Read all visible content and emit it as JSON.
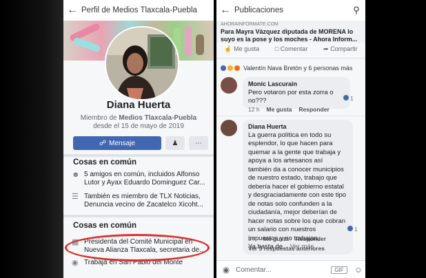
{
  "left": {
    "header_title": "Perfil de Medios Tlaxcala-Puebla",
    "profile_name": "Diana Huerta",
    "member_line_prefix": "Miembro de ",
    "member_group": "Medios Tlaxcala-Puebla",
    "member_since": "desde el 15 de mayo de 2019",
    "message_button": "Mensaje",
    "section1_title": "Cosas en común",
    "friends_text": "5 amigos en común, incluidos Alfonso Lutor y Ayax Eduardo Dominguez Car...",
    "groups_text": "También es miembro de TLX Noticias, Denuncia vecino de Zacatelco Xicoht...",
    "section2_title": "Cosas en común",
    "job_text": "Presidenta del Comité Municipal en Nueva Alianza Tlaxcala, secretaria de...",
    "work_text": "Trabaja en San Pablo del Monte"
  },
  "right": {
    "header_title": "Publicaciones",
    "link_domain": "AHORAINFORMATE.COM",
    "link_title": "Para Mayra Vázquez diputada de MORENA lo suyo es la pose y los moches - Ahora Inform...",
    "like": "Me gusta",
    "comment": "Comentar",
    "share": "Compartir",
    "reactions_text": "Valentín Nava Bretón y 6 personas más",
    "comments": [
      {
        "author": "Monic Lascurain",
        "text": "Pero votaron por esta zorra o no???",
        "time": "12 h",
        "like": "Me gusta",
        "reply": "Responder",
        "reaction_count": "1"
      },
      {
        "author": "Diana Huerta",
        "text": "La guerra política en todo su esplendor, lo que hacen para quemar a la gente que trabaja y apoya a los artesanos así también da a conocer municipios de nuestro estado, trabajo que debería hacer el gobierno estatal y desgraciadamente con este tipo de notas solo confunden a la ciudadanía, mejor deberían de hacer notas sobre los que cobran un salario con nuestros impuestos y no trabajan.",
        "more_prefix": "Ya basta de...",
        "see_more": "Ver más",
        "time": "9 h",
        "like": "Me gusta",
        "reply": "Responder",
        "reaction_count": "1"
      }
    ],
    "more_replies": "Ver 5 respuestas anteriores",
    "composer_placeholder": "Comentar..."
  },
  "colors": {
    "fb_blue": "#4267b2",
    "highlight_red": "#d9302c"
  }
}
